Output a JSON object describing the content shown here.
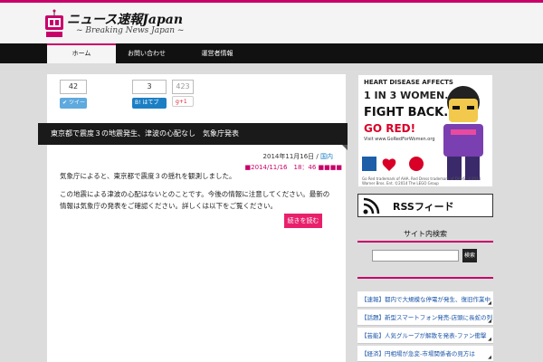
{
  "header": {
    "title": "ニュース速報Japan",
    "tagline": "~ Breaking News Japan ~"
  },
  "nav": {
    "items": [
      "ホーム",
      "お問い合わせ",
      "運営者情報"
    ]
  },
  "share": {
    "tweet_count": "42",
    "tweet_label": "ツイート",
    "hatena_count": "3",
    "hatena_label": "はてブ",
    "gplus_count": "423",
    "gplus_label": "+1"
  },
  "post": {
    "title": "東京都で震度３の地震発生、津波の心配なし　気象庁発表",
    "date": "2014年11月16日",
    "date_sep": " / ",
    "category": "国内",
    "stamp": "■2014/11/16　18：46 ■■■■",
    "para1": "気象庁によると、東京都で震度３の揺れを観測しました。",
    "para2": "この地震による津波の心配はないとのことです。今後の情報に注意してください。最新の情報は気象庁の発表をご確認ください。詳しくは以下をご覧ください。",
    "readmore": "続きを読む"
  },
  "sidebar": {
    "ad": {
      "line1": "HEART DISEASE AFFECTS",
      "line2": "1 IN 3 WOMEN.",
      "line3": "FIGHT BACK.",
      "line4": "GO RED!",
      "line5": "Visit www.GoRedForWomen.org",
      "fine": "Go Red trademark of AHA. Red Dress trademark of DHHS. ©2014 Warner Bros. Ent. ©2014 The LEGO Group"
    },
    "rss_label": "RSSフィード",
    "search_title": "サイト内検索",
    "search_button": "検索",
    "related": [
      "【速報】都内で大規模な停電が発生、復旧作業中",
      "【話題】新型スマートフォン発売-店頭に長蛇の列",
      "【芸能】人気グループが解散を発表-ファン衝撃",
      "【経済】円相場が急変-市場関係者の見方は"
    ]
  },
  "colors": {
    "accent": "#c8006a",
    "nav_bg": "#111111",
    "readmore_bg": "#e8206c"
  }
}
